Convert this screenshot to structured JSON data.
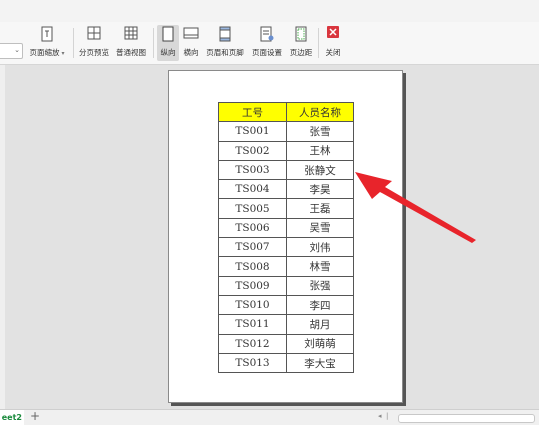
{
  "toolbar": {
    "zoom_label": "页面缩放",
    "split_preview": "分页预览",
    "normal_view": "普通视图",
    "portrait": "纵向",
    "landscape": "横向",
    "header_footer": "页眉和页脚",
    "page_setup": "页面设置",
    "margins": "页边距",
    "close": "关闭"
  },
  "table": {
    "headers": [
      "工号",
      "人员名称"
    ],
    "rows": [
      [
        "TS001",
        "张雪"
      ],
      [
        "TS002",
        "王林"
      ],
      [
        "TS003",
        "张静文"
      ],
      [
        "TS004",
        "李昊"
      ],
      [
        "TS005",
        "王磊"
      ],
      [
        "TS006",
        "吴雪"
      ],
      [
        "TS007",
        "刘伟"
      ],
      [
        "TS008",
        "林雪"
      ],
      [
        "TS009",
        "张强"
      ],
      [
        "TS010",
        "李四"
      ],
      [
        "TS011",
        "胡月"
      ],
      [
        "TS012",
        "刘萌萌"
      ],
      [
        "TS013",
        "李大宝"
      ]
    ]
  },
  "sheet": {
    "tab_label": "eet2",
    "add_label": "+"
  },
  "colors": {
    "header_fill": "#ffff00",
    "arrow": "#e8242b",
    "close_icon": "#d9363e",
    "sheet_tab_text": "#1a8a3c"
  },
  "icons": [
    "split-preview-icon",
    "normal-view-icon",
    "portrait-icon",
    "landscape-icon",
    "header-footer-icon",
    "page-setup-icon",
    "margins-icon",
    "close-icon",
    "annotation-arrow"
  ]
}
